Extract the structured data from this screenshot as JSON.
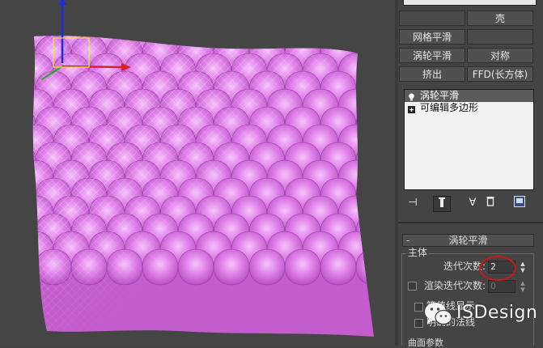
{
  "colors": {
    "viewport_bg": "#454545",
    "panel_bg": "#444444",
    "mesh_pink": "#d86fe0",
    "mesh_light": "#f1b7f6",
    "wire": "#ffffff",
    "annotation_red": "#cc1818"
  },
  "modifier_buttons": {
    "b1": "",
    "b2": "壳",
    "b3": "网格平滑",
    "b4": "",
    "b5": "涡轮平滑",
    "b6": "对称",
    "b7": "挤出",
    "b8": "FFD(长方体)"
  },
  "modifier_stack": [
    {
      "label": "涡轮平滑",
      "icon": "light-bulb-icon",
      "selected": true
    },
    {
      "label": "可编辑多边形",
      "icon": "expand-plus-icon",
      "selected": false
    }
  ],
  "stack_tools": [
    "pin-stack-icon",
    "show-end-result-icon",
    "make-unique-icon",
    "remove-modifier-icon",
    "configure-modifier-sets-icon"
  ],
  "rollout": {
    "collapse": "-",
    "title": "涡轮平滑",
    "group_main": "主体",
    "iterations_label": "迭代次数:",
    "iterations_value": "2",
    "render_iters_label": "渲染迭代次数:",
    "render_iters_value": "0",
    "isoline_label": "等值线显示",
    "explicit_normals_label": "明确的法线",
    "surface_params_label": "曲面参数"
  },
  "watermark": {
    "icon": "wechat-icon",
    "text": "ISDesign"
  }
}
